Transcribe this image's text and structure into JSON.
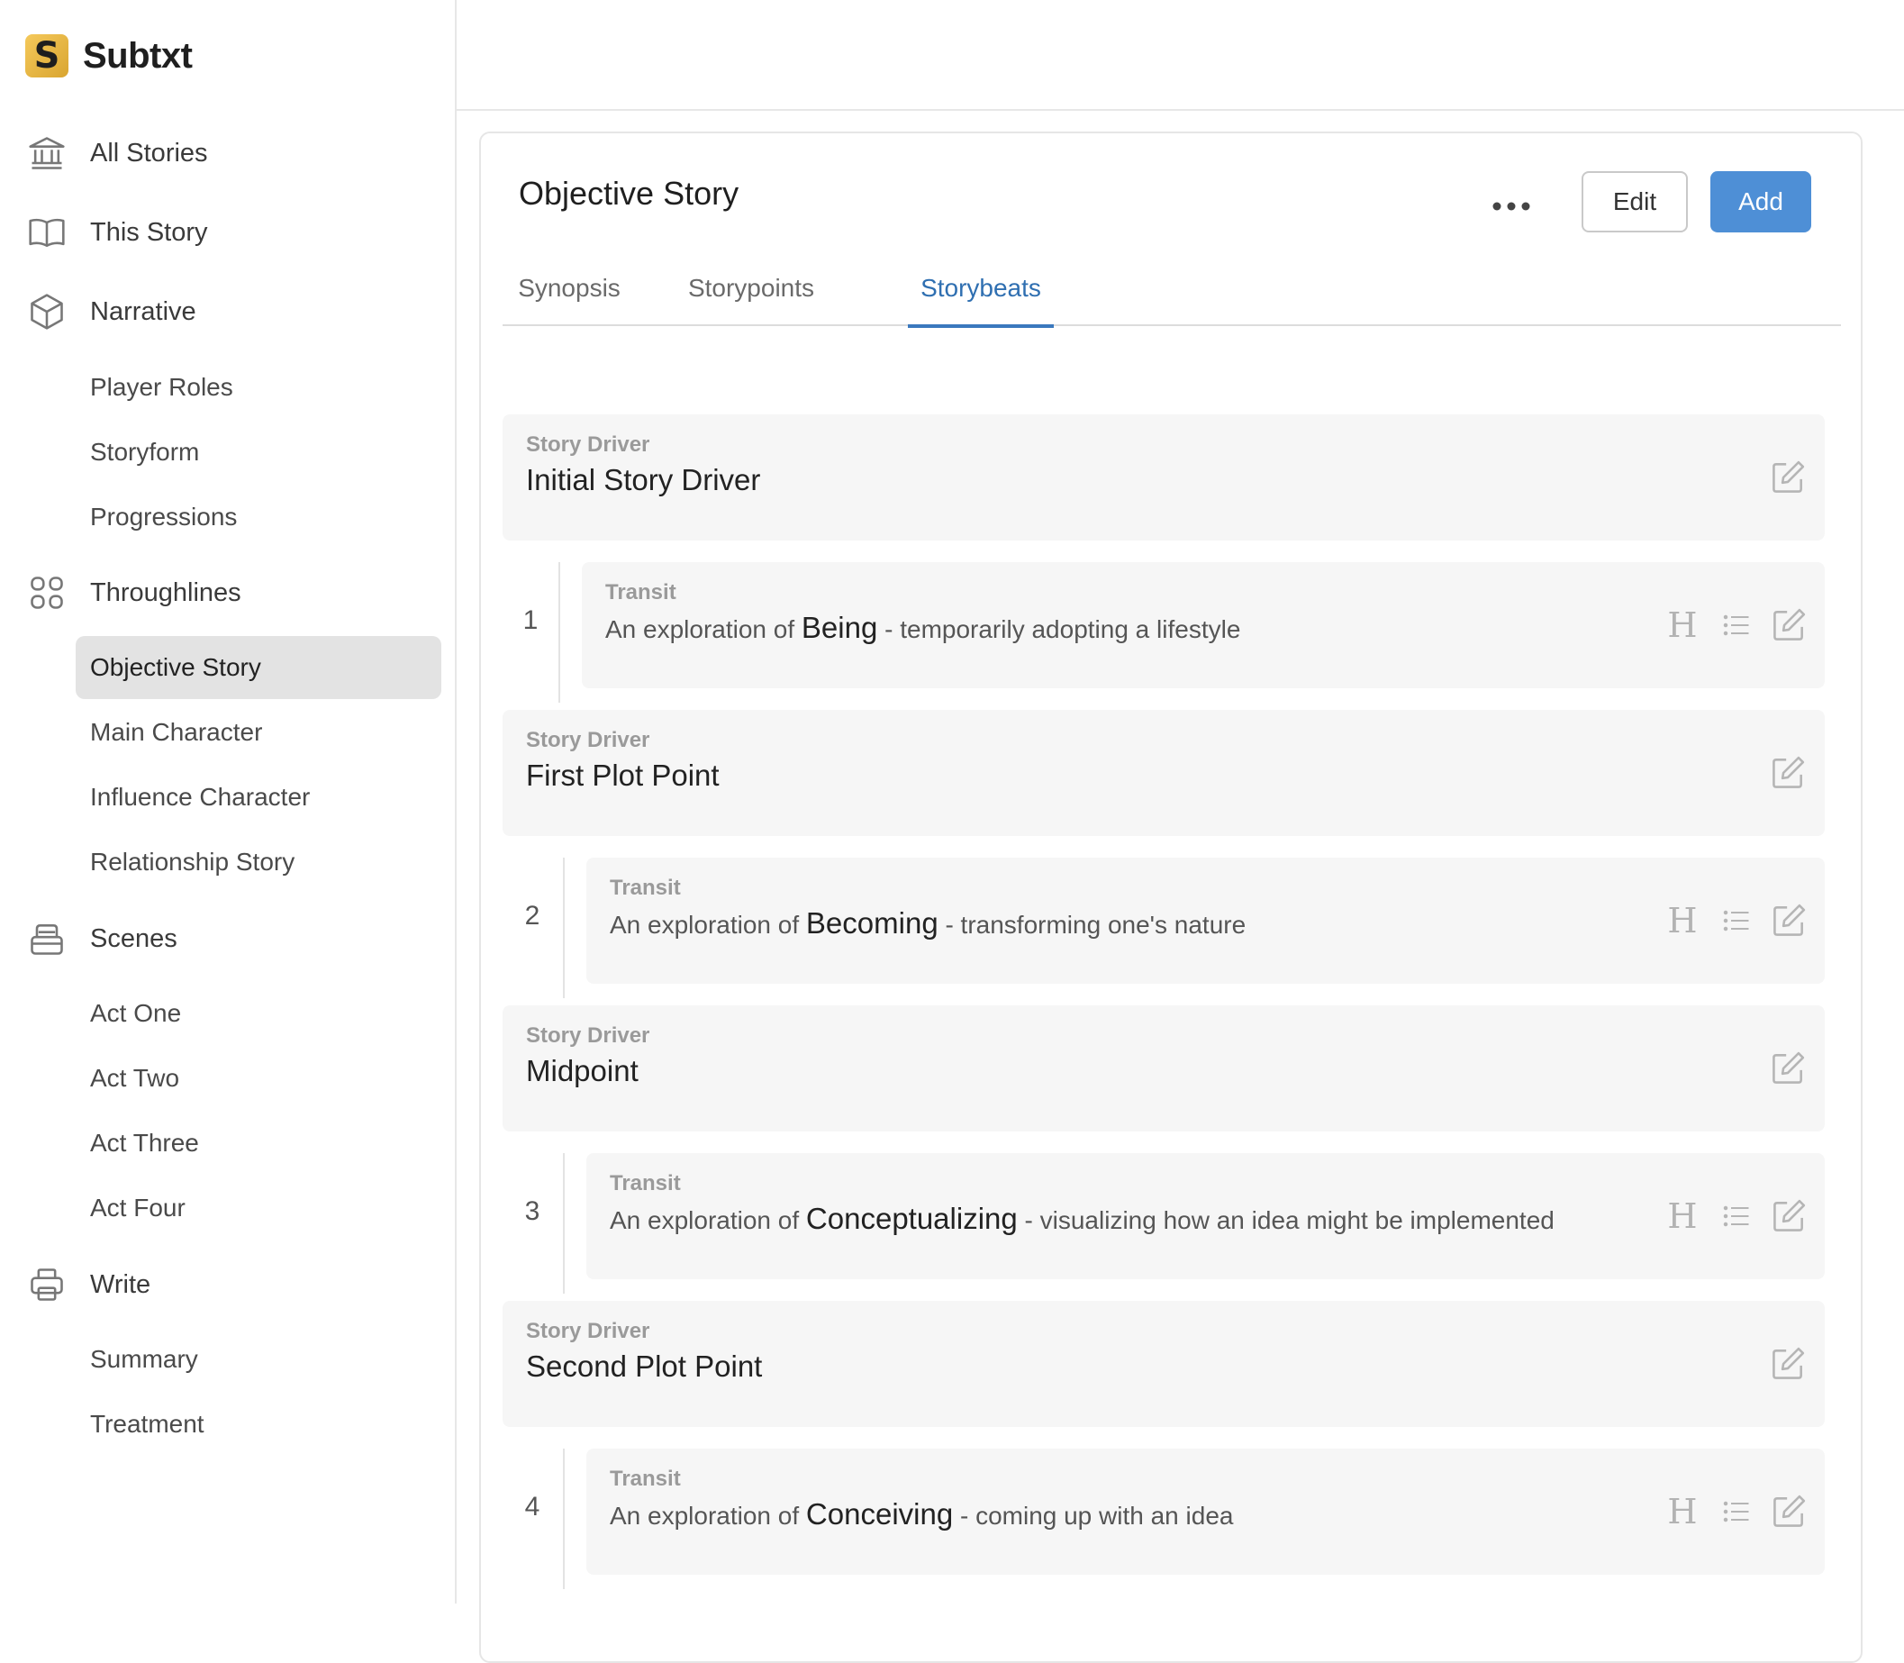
{
  "brand": {
    "name": "Subtxt",
    "logo_letter": "S",
    "accent": "#e0b040"
  },
  "sidebar": {
    "items": [
      {
        "label": "All Stories",
        "icon": "bank-icon"
      },
      {
        "label": "This Story",
        "icon": "book-icon"
      },
      {
        "label": "Narrative",
        "icon": "cube-icon"
      },
      {
        "label": "Throughlines",
        "icon": "grid-icon"
      },
      {
        "label": "Scenes",
        "icon": "inbox-icon"
      },
      {
        "label": "Write",
        "icon": "printer-icon"
      }
    ],
    "narrative_sub": [
      "Player Roles",
      "Storyform",
      "Progressions"
    ],
    "throughlines_sub": [
      "Objective Story",
      "Main Character",
      "Influence Character",
      "Relationship Story"
    ],
    "scenes_sub": [
      "Act One",
      "Act Two",
      "Act Three",
      "Act Four"
    ],
    "write_sub": [
      "Summary",
      "Treatment"
    ],
    "active": "Objective Story"
  },
  "main": {
    "title": "Objective Story",
    "edit_label": "Edit",
    "add_label": "Add",
    "tabs": [
      "Synopsis",
      "Storypoints",
      "Storybeats"
    ],
    "active_tab": "Storybeats",
    "accent": "#4e8fd6"
  },
  "beats": {
    "driver_label": "Story Driver",
    "transit_label": "Transit",
    "prefix": "An exploration of",
    "drivers": [
      "Initial Story Driver",
      "First Plot Point",
      "Midpoint",
      "Second Plot Point"
    ],
    "transits": [
      {
        "num": "1",
        "term": "Being",
        "desc": "- temporarily adopting a lifestyle"
      },
      {
        "num": "2",
        "term": "Becoming",
        "desc": "- transforming one's nature"
      },
      {
        "num": "3",
        "term": "Conceptualizing",
        "desc": "- visualizing how an idea might be implemented"
      },
      {
        "num": "4",
        "term": "Conceiving",
        "desc": "- coming up with an idea"
      }
    ],
    "heading_glyph": "H"
  }
}
